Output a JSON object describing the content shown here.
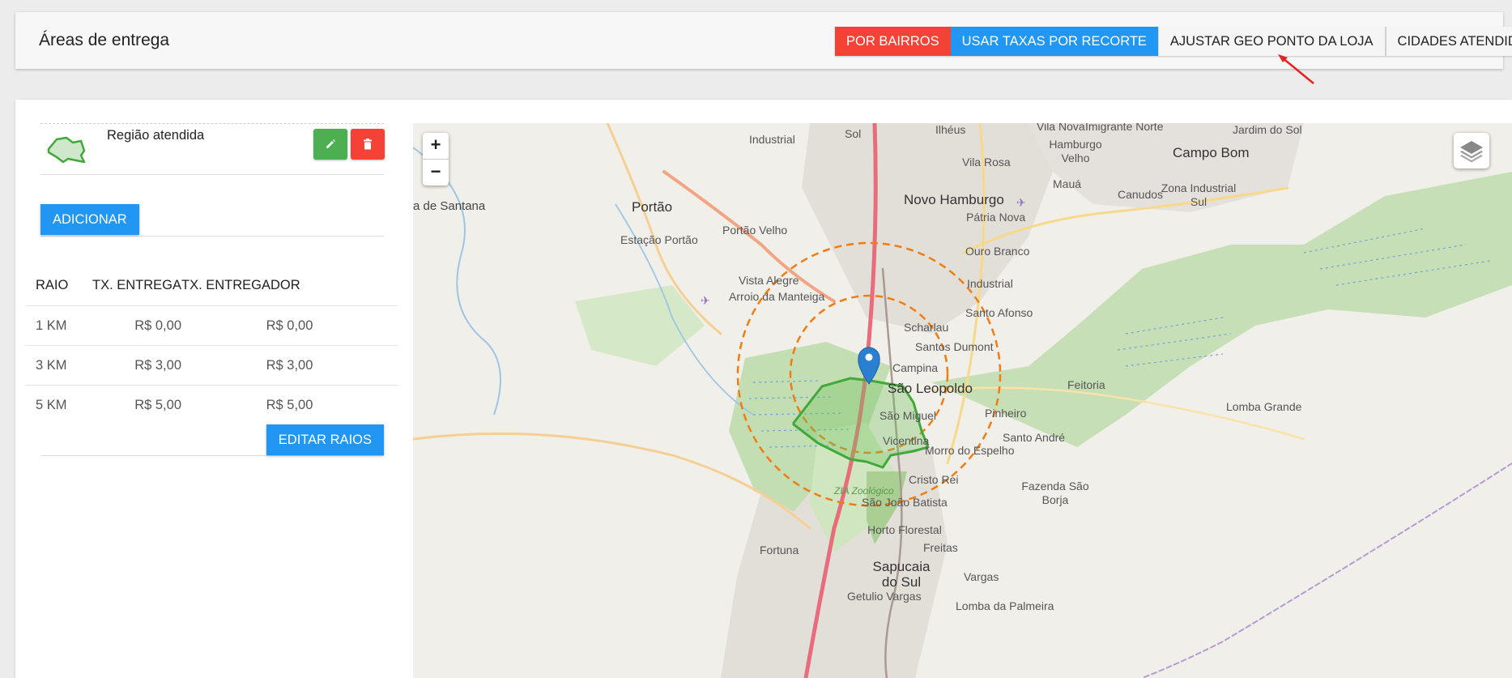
{
  "header": {
    "title": "Áreas de entrega",
    "buttons": {
      "por_bairros": "POR BAIRROS",
      "usar_taxas": "USAR TAXAS POR RECORTE",
      "ajustar_geo": "AJUSTAR GEO PONTO DA LOJA",
      "cidades": "CIDADES ATENDIDAS"
    }
  },
  "region": {
    "label": "Região atendida"
  },
  "actions": {
    "add": "ADICIONAR",
    "edit_radii": "EDITAR RAIOS"
  },
  "radii_table": {
    "headers": [
      "RAIO",
      "TX. ENTREGA",
      "TX. ENTREGADOR"
    ],
    "rows": [
      [
        "1 KM",
        "R$ 0,00",
        "R$ 0,00"
      ],
      [
        "3 KM",
        "R$ 3,00",
        "R$ 3,00"
      ],
      [
        "5 KM",
        "R$ 5,00",
        "R$ 5,00"
      ]
    ]
  },
  "map": {
    "zoom_in": "+",
    "zoom_out": "−",
    "labels": {
      "l01": "Ilhéus",
      "l02": "Vila Nova",
      "l03": "Imigrante Norte",
      "l04": "Jardim do Sol",
      "l05": "Industrial",
      "l06": "Hamburgo Velho",
      "l07": "Campo Bom",
      "l08": "Sol",
      "l09": "Vila Rosa",
      "l10": "Mauá",
      "l11": "Canudos",
      "l12": "Zona Industrial Sul",
      "l13": "a de Santana",
      "l14": "Portão",
      "l15": "Novo Hamburgo",
      "l16": "Pátria Nova",
      "l17": "Portão Velho",
      "l18": "Estação Portão",
      "l19": "Ouro Branco",
      "l20": "Industrial",
      "l21": "Vista Alegre",
      "l22": "Arroio da Manteiga",
      "l23": "Santo Afonso",
      "l24": "Scharlau",
      "l25": "Santos Dumont",
      "l26": "Campina",
      "l27": "São Leopoldo",
      "l28": "Feitoria",
      "l29": "São Miguel",
      "l30": "Pinheiro",
      "l31": "Lomba Grande",
      "l32": "Santo André",
      "l33": "Vicentina",
      "l34": "Morro do Espelho",
      "l35": "Cristo Rei",
      "l36": "ZIA Zoológico",
      "l37": "Fazenda São Borja",
      "l38": "São João Batista",
      "l39": "Horto Florestal",
      "l40": "Fortuna",
      "l41": "Freitas",
      "l42": "Sapucaia do Sul",
      "l43": "Vargas",
      "l44": "Getulio Vargas",
      "l45": "Lomba da Palmeira"
    }
  },
  "colors": {
    "red": "#f44336",
    "blue": "#2196f3",
    "green": "#4caf50",
    "region_outline": "#43a83a",
    "radius_ring": "#ef7d12",
    "marker": "#2a7fd0"
  }
}
